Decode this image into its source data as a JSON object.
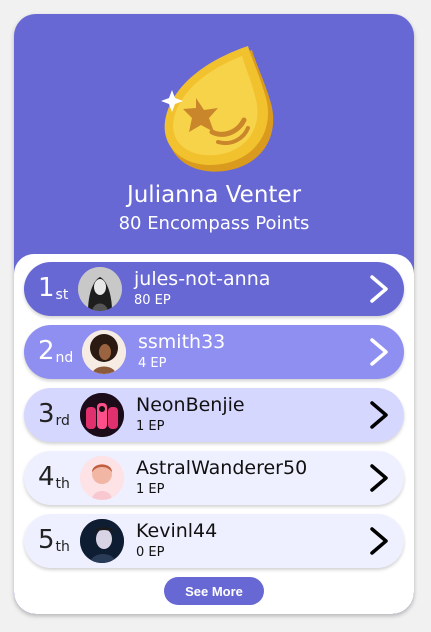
{
  "profile": {
    "name": "Julianna Venter",
    "points": "80 Encompass Points"
  },
  "leaderboard": [
    {
      "rank": "1",
      "suffix": "st",
      "username": "jules-not-anna",
      "ep": "80 EP",
      "row_color": "#6768d4"
    },
    {
      "rank": "2",
      "suffix": "nd",
      "username": "ssmith33",
      "ep": "4 EP",
      "row_color": "#8f8ff2"
    },
    {
      "rank": "3",
      "suffix": "rd",
      "username": "NeonBenjie",
      "ep": "1 EP",
      "row_color": "#d6d7ff"
    },
    {
      "rank": "4",
      "suffix": "th",
      "username": "AstralWanderer50",
      "ep": "1 EP",
      "row_color": "#eef0ff"
    },
    {
      "rank": "5",
      "suffix": "th",
      "username": "Kevinl44",
      "ep": "0 EP",
      "row_color": "#eef0ff"
    }
  ],
  "see_more_label": "See More",
  "colors": {
    "brand": "#6768d4",
    "coin": "#f2c12e"
  },
  "icons": [
    "coin-drop-icon",
    "star-icon",
    "chevron-right-icon"
  ]
}
